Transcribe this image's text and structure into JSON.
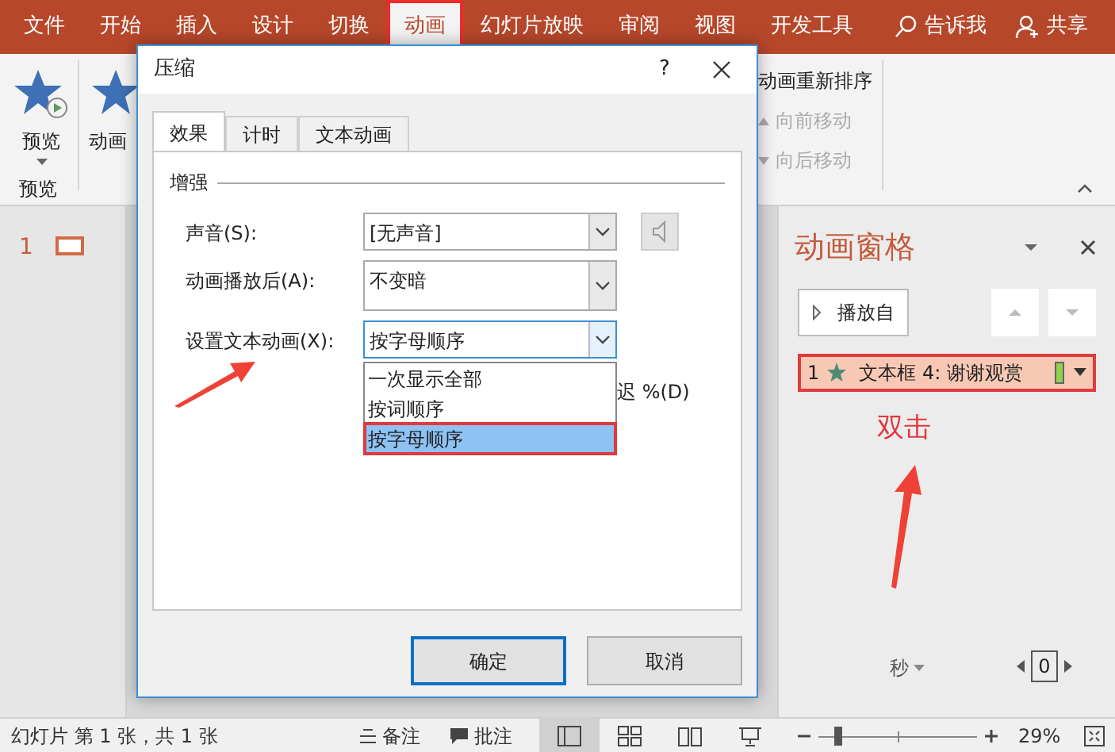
{
  "menu_tabs": [
    {
      "label": "文件",
      "selected": false,
      "annotated": false
    },
    {
      "label": "开始",
      "selected": false,
      "annotated": false
    },
    {
      "label": "插入",
      "selected": false,
      "annotated": false
    },
    {
      "label": "设计",
      "selected": false,
      "annotated": false
    },
    {
      "label": "切换",
      "selected": false,
      "annotated": false
    },
    {
      "label": "动画",
      "selected": true,
      "annotated": true
    },
    {
      "label": "幻灯片放映",
      "selected": false,
      "annotated": false
    },
    {
      "label": "审阅",
      "selected": false,
      "annotated": false
    },
    {
      "label": "视图",
      "selected": false,
      "annotated": false
    },
    {
      "label": "开发工具",
      "selected": false,
      "annotated": false
    }
  ],
  "tell_me": "告诉我",
  "share": "共享",
  "ribbon": {
    "preview_button": "预览",
    "preview_group": "预览",
    "animation_styles": "动画",
    "reorder_title": "动画重新排序",
    "move_earlier": {
      "label": "向前移动",
      "disabled": true
    },
    "move_later": {
      "label": "向后移动",
      "disabled": true
    }
  },
  "slides": [
    {
      "number": "1",
      "selected": true
    }
  ],
  "dialog": {
    "title": "压缩",
    "help": "?",
    "tabs": [
      {
        "label": "效果",
        "selected": true
      },
      {
        "label": "计时",
        "selected": false
      },
      {
        "label": "文本动画",
        "selected": false
      }
    ],
    "section": "增强",
    "fields": [
      {
        "label": "声音(S):",
        "value": "[无声音]",
        "kind": "sound"
      },
      {
        "label": "动画播放后(A):",
        "value": "不变暗",
        "kind": "tall"
      },
      {
        "label": "设置文本动画(X):",
        "value": "按字母顺序",
        "kind": "open"
      }
    ],
    "options": [
      {
        "label": "一次显示全部",
        "selected": false,
        "annotated": false
      },
      {
        "label": "按词顺序",
        "selected": false,
        "annotated": false
      },
      {
        "label": "按字母顺序",
        "selected": true,
        "annotated": true
      }
    ],
    "delay_label": "迟 %(D)",
    "buttons": [
      {
        "label": "确定",
        "default": true
      },
      {
        "label": "取消",
        "default": false
      }
    ]
  },
  "animation_pane": {
    "title": "动画窗格",
    "play_from": "播放自",
    "items": [
      {
        "number": "1",
        "label": "文本框 4: 谢谢观赏",
        "color": "#92d050",
        "annotated": true
      }
    ],
    "annotation": "双击",
    "unit": "秒",
    "counter": "0"
  },
  "status_bar": {
    "slide_info": "幻灯片 第 1 张，共 1 张",
    "notes": "备注",
    "comments": "批注",
    "views": [
      {
        "kind": "normal",
        "selected": true
      },
      {
        "kind": "sorter",
        "selected": false
      },
      {
        "kind": "reading",
        "selected": false
      },
      {
        "kind": "slideshow",
        "selected": false
      }
    ],
    "zoom": {
      "level": 0.1
    },
    "zoom_text": "29%"
  }
}
